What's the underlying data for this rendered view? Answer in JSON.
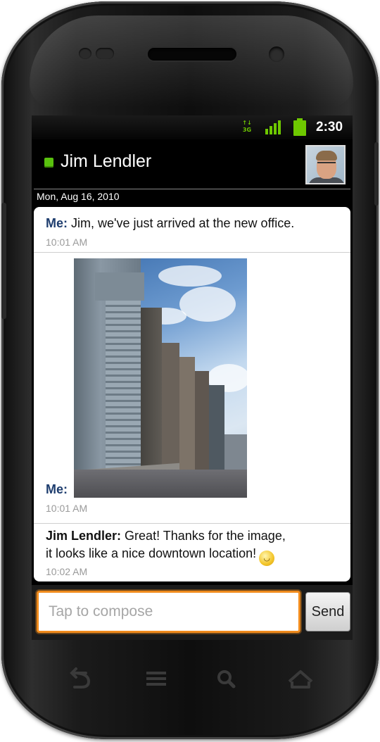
{
  "status_bar": {
    "network": "3G",
    "time": "2:30"
  },
  "contact": {
    "name": "Jim Lendler",
    "presence": "online"
  },
  "conversation": {
    "date": "Mon, Aug 16, 2010",
    "messages": [
      {
        "sender": "Me:",
        "text": "Jim, we've just arrived at the new office.",
        "time": "10:01 AM"
      },
      {
        "sender": "Me:",
        "text": "",
        "attachment": "photo of downtown office buildings",
        "time": "10:01 AM"
      },
      {
        "sender": "Jim Lendler:",
        "text_line1": "Great! Thanks for the image,",
        "text_line2": "it looks like a nice downtown location!",
        "emoticon": "smiley",
        "time": "10:02 AM"
      }
    ]
  },
  "compose": {
    "placeholder": "Tap to compose",
    "send_label": "Send"
  },
  "nav_keys": [
    "back-icon",
    "menu-icon",
    "search-icon",
    "home-icon"
  ],
  "colors": {
    "presence": "#59c10e",
    "status_icons": "#6ec800",
    "compose_focus": "#f08b1d",
    "sender_me": "#1e3d6e"
  }
}
